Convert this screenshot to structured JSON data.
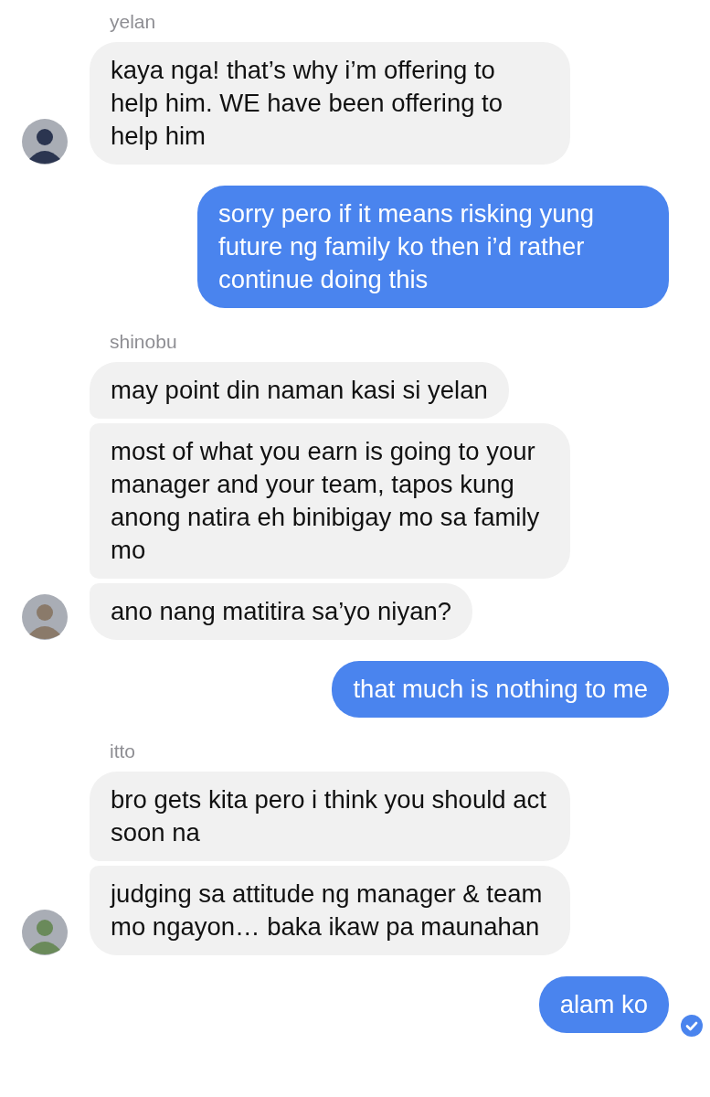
{
  "messages": [
    {
      "kind": "received",
      "sender": "yelan",
      "bubbles": [
        {
          "text": "kaya nga! that’s why i’m offering to help him. WE have been offering to help him",
          "read": false
        }
      ]
    },
    {
      "kind": "sent",
      "bubbles": [
        {
          "text": "sorry pero if it means risking yung future ng family ko then i’d rather continue doing this",
          "read": false
        }
      ]
    },
    {
      "kind": "received",
      "sender": "shinobu",
      "bubbles": [
        {
          "text": "may point din naman kasi si yelan",
          "read": false
        },
        {
          "text": "most of what you earn is going to your manager and your team, tapos kung anong natira eh binibigay mo sa family mo",
          "read": false
        },
        {
          "text": "ano nang matitira sa’yo niyan?",
          "read": false
        }
      ]
    },
    {
      "kind": "sent",
      "bubbles": [
        {
          "text": "that much is nothing to me",
          "read": false
        }
      ]
    },
    {
      "kind": "received",
      "sender": "itto",
      "bubbles": [
        {
          "text": "bro gets kita pero i think you should act soon na",
          "read": false
        },
        {
          "text": "judging sa attitude ng manager & team mo ngayon… baka ikaw pa maunahan",
          "read": false
        }
      ]
    },
    {
      "kind": "sent",
      "bubbles": [
        {
          "text": "alam ko",
          "read": true
        }
      ]
    }
  ]
}
